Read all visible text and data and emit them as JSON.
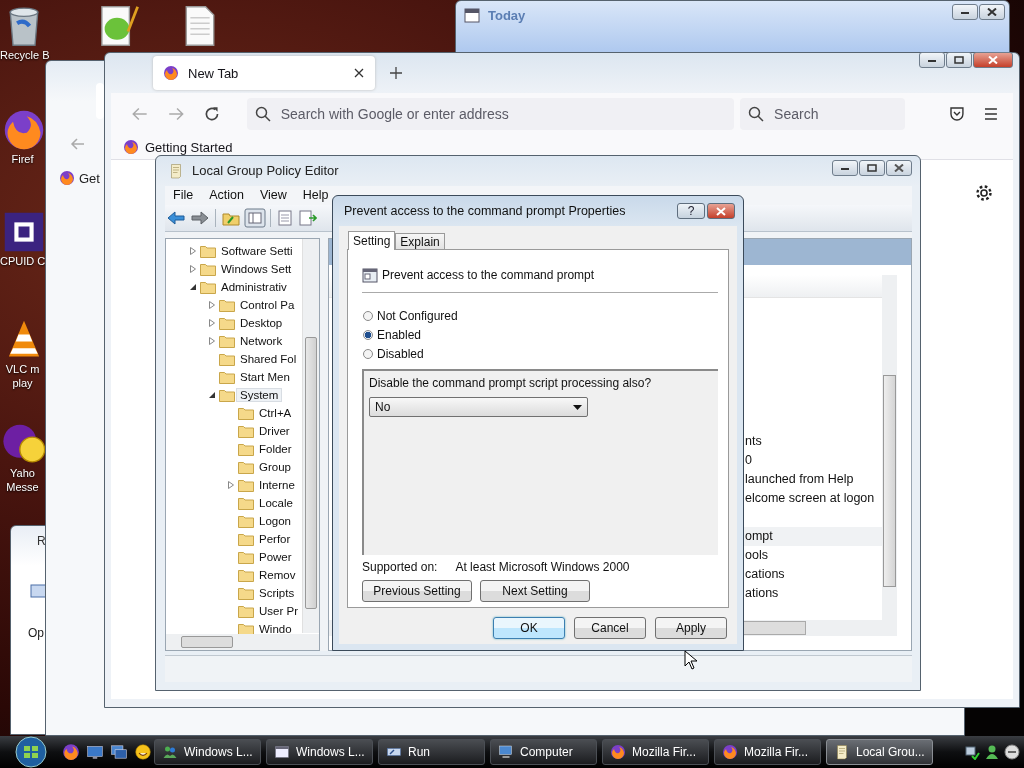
{
  "desktop": {
    "top_icons": [
      {
        "kind": "notepad"
      },
      {
        "kind": "doc"
      }
    ],
    "icons": [
      {
        "kind": "bin",
        "lines": [
          "Recycle B"
        ]
      },
      {
        "kind": "fox",
        "lines": [
          "Firef"
        ]
      },
      {
        "kind": "chip",
        "lines": [
          "CPUID C"
        ]
      },
      {
        "kind": "cone",
        "lines": [
          "VLC m",
          "play"
        ]
      },
      {
        "kind": "yahoo",
        "lines": [
          "Yaho",
          "Messe"
        ]
      }
    ]
  },
  "today_window": {
    "title": "Today"
  },
  "side_window": {
    "title": "R",
    "link": "Op"
  },
  "background_browser": {
    "bookmark": "Get"
  },
  "browser": {
    "tab": "New Tab",
    "address_placeholder": "Search with Google or enter address",
    "search_placeholder": "Search",
    "bookmarks": [
      "Getting Started"
    ]
  },
  "policy_editor": {
    "title": "Local Group Policy Editor",
    "menu": [
      "File",
      "Action",
      "View",
      "Help"
    ],
    "tree": [
      {
        "label": "Software Setti",
        "expanded": false,
        "selected": false
      },
      {
        "label": "Windows Sett",
        "expanded": false,
        "selected": false
      },
      {
        "label": "Administrativ",
        "expanded": true,
        "selected": false,
        "children": [
          {
            "label": "Control Pa",
            "expanded": false,
            "selected": false
          },
          {
            "label": "Desktop",
            "expanded": false,
            "selected": false
          },
          {
            "label": "Network",
            "expanded": false,
            "selected": false
          },
          {
            "label": "Shared Fol",
            "selected": false
          },
          {
            "label": "Start Men",
            "selected": false
          },
          {
            "label": "System",
            "expanded": true,
            "selected": true,
            "children": [
              {
                "label": "Ctrl+A",
                "selected": false
              },
              {
                "label": "Driver",
                "selected": false
              },
              {
                "label": "Folder",
                "selected": false
              },
              {
                "label": "Group",
                "selected": false
              },
              {
                "label": "Interne",
                "expanded": false,
                "selected": false
              },
              {
                "label": "Locale",
                "selected": false
              },
              {
                "label": "Logon",
                "selected": false
              },
              {
                "label": "Perfor",
                "selected": false
              },
              {
                "label": "Power",
                "selected": false
              },
              {
                "label": "Remov",
                "selected": false
              },
              {
                "label": "Scripts",
                "selected": false
              },
              {
                "label": "User Pr",
                "selected": false
              },
              {
                "label": "Windo",
                "selected": false
              }
            ]
          }
        ]
      }
    ],
    "list": [
      {
        "text": "nts",
        "selected": false
      },
      {
        "text": "0",
        "selected": false
      },
      {
        "text": "launched from Help",
        "selected": false
      },
      {
        "text": "elcome screen at logon",
        "selected": false
      },
      {
        "text": "ompt",
        "selected": true
      },
      {
        "text": "ools",
        "selected": false
      },
      {
        "text": "cations",
        "selected": false
      },
      {
        "text": "ations",
        "selected": false
      }
    ]
  },
  "dialog": {
    "title": "Prevent access to the command prompt Properties",
    "help_button": "?",
    "tabs": [
      {
        "label": "Setting",
        "selected": true
      },
      {
        "label": "Explain",
        "selected": false
      }
    ],
    "policy": "Prevent access to the command prompt",
    "options": [
      {
        "label": "Not Configured",
        "selected": false
      },
      {
        "label": "Enabled",
        "selected": true
      },
      {
        "label": "Disabled",
        "selected": false
      }
    ],
    "question": "Disable the command prompt script processing also?",
    "dropdown": "No",
    "supported_label": "Supported on:",
    "supported_value": "At least Microsoft Windows 2000",
    "nav_buttons": [
      "Previous Setting",
      "Next Setting"
    ],
    "buttons": [
      {
        "label": "OK",
        "default": true
      },
      {
        "label": "Cancel",
        "default": false
      },
      {
        "label": "Apply",
        "default": false
      }
    ]
  },
  "taskbar": {
    "quick_launch": [
      {
        "kind": "fox"
      },
      {
        "kind": "desktop"
      },
      {
        "kind": "switch"
      },
      {
        "kind": "smiley"
      }
    ],
    "tasks": [
      {
        "label": "Windows L...",
        "kind": "messenger",
        "selected": false
      },
      {
        "label": "Windows L...",
        "kind": "window",
        "selected": false
      },
      {
        "label": "Run",
        "kind": "run",
        "selected": false
      },
      {
        "label": "Computer",
        "kind": "computer",
        "selected": false
      },
      {
        "label": "Mozilla Fir...",
        "kind": "fox",
        "selected": false
      },
      {
        "label": "Mozilla Fir...",
        "kind": "fox",
        "selected": false
      },
      {
        "label": "Local Grou...",
        "kind": "policy",
        "selected": true
      }
    ]
  }
}
